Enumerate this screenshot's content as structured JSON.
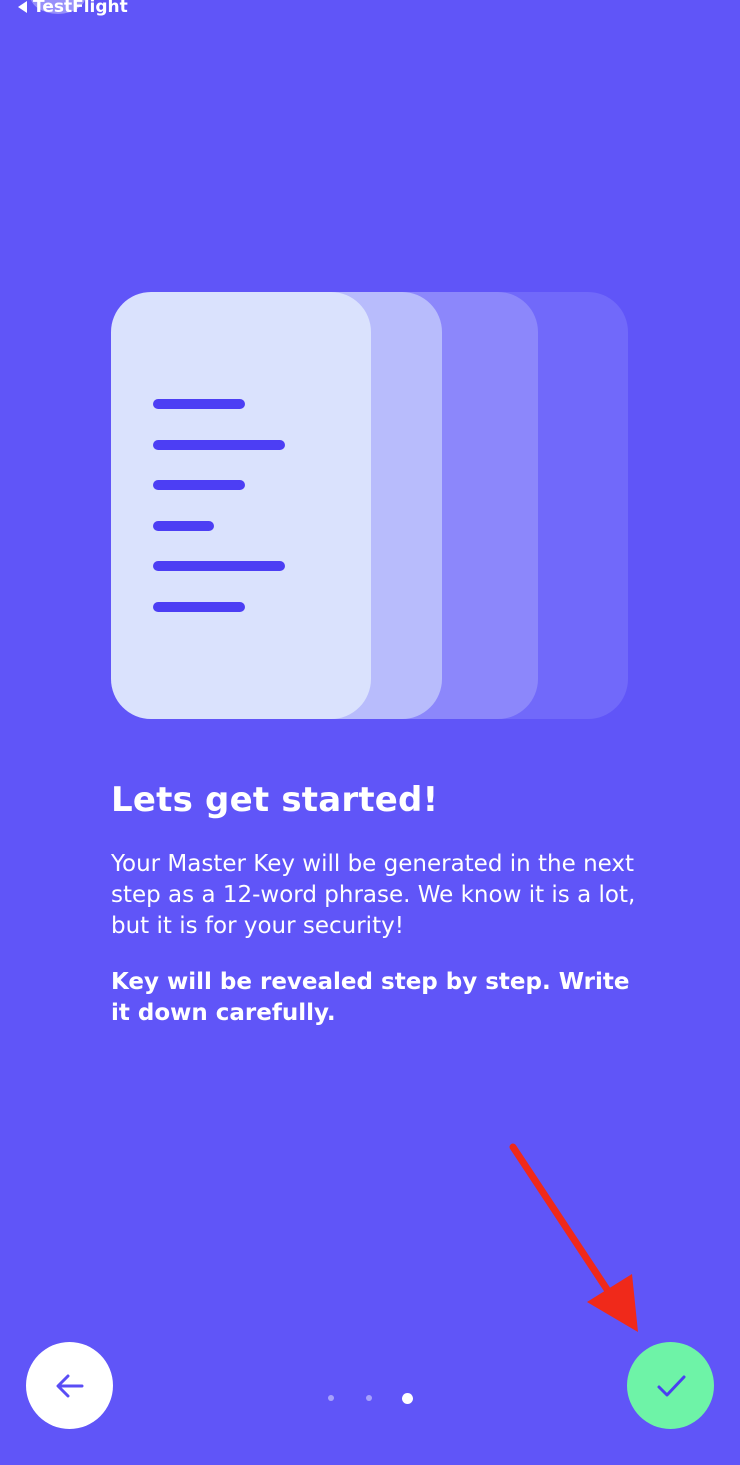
{
  "status_bar": {
    "back_app_label": "TestFlight",
    "back_icon": "back-triangle-icon"
  },
  "onboarding": {
    "illustration_icon": "document-stack-icon",
    "heading": "Lets get started!",
    "body": "Your Master Key will be generated in the next step as a 12-word phrase. We know it is a lot, but it is for your security!",
    "body_bold": "Key will be revealed step by step. Write it down carefully."
  },
  "navigation": {
    "back_icon": "arrow-left-icon",
    "done_icon": "checkmark-icon",
    "page_count": 3,
    "current_page": 3
  },
  "colors": {
    "background": "#6055f8",
    "accent_green": "#6ef3a7",
    "line_color": "#4c3ef4",
    "annotation_arrow": "#f0291a"
  }
}
